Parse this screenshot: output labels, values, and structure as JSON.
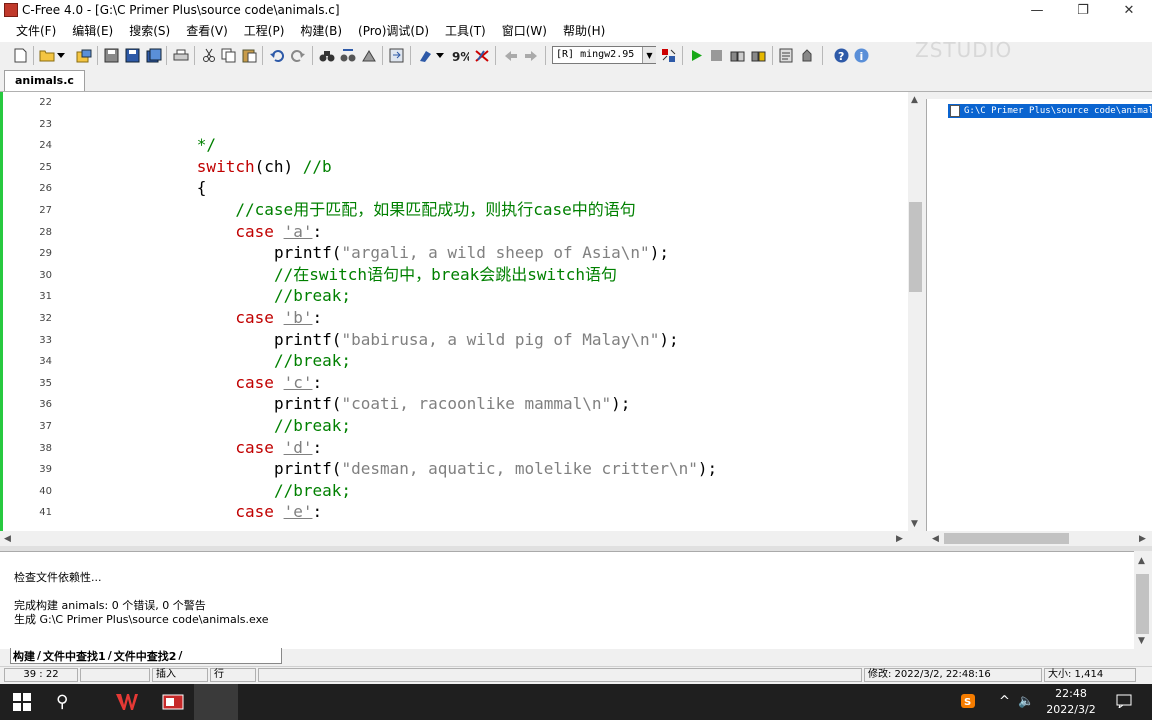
{
  "window": {
    "title": "C-Free 4.0 - [G:\\C Primer Plus\\source code\\animals.c]",
    "minimize_glyph": "—",
    "restore_glyph": "❐",
    "close_glyph": "✕"
  },
  "menu": [
    "文件(F)",
    "编辑(E)",
    "搜索(S)",
    "查看(V)",
    "工程(P)",
    "构建(B)",
    "(Pro)调试(D)",
    "工具(T)",
    "窗口(W)",
    "帮助(H)"
  ],
  "toolbar": {
    "compiler": "[R] mingw2.95",
    "icons": [
      "new-file-icon",
      "open-folder-icon",
      "open-dropdown-icon",
      "open-project-icon",
      "save-all-icon",
      "save-icon",
      "save-as-icon",
      "close-file-icon",
      "print-icon",
      "cut-icon",
      "copy-icon",
      "paste-icon",
      "delete-icon",
      "undo-icon",
      "redo-icon",
      "find-icon",
      "find-next-icon",
      "replace-icon",
      "goto-icon",
      "bookmark-icon",
      "bookmark-dropdown-icon",
      "toggle-bookmark-icon",
      "clear-bookmark-icon",
      "nav-back-icon",
      "nav-forward-icon",
      "compiler-settings-icon",
      "run-icon",
      "stop-icon",
      "build-icon",
      "rebuild-icon",
      "compile-icon",
      "debug-icon",
      "help-icon",
      "info-icon"
    ],
    "watermark": "ZSTUDIO"
  },
  "tabs": [
    "animals.c"
  ],
  "editor": {
    "lines": [
      {
        "n": "22",
        "parts": []
      },
      {
        "n": "23",
        "parts": []
      },
      {
        "n": "24",
        "indent": 12,
        "parts": [
          {
            "t": "*/",
            "c": "cmt"
          }
        ]
      },
      {
        "n": "25",
        "indent": 12,
        "parts": [
          {
            "t": "switch",
            "c": "kw"
          },
          {
            "t": "(ch) ",
            "c": ""
          },
          {
            "t": "//b",
            "c": "cmt"
          }
        ]
      },
      {
        "n": "26",
        "indent": 12,
        "parts": [
          {
            "t": "{",
            "c": ""
          }
        ]
      },
      {
        "n": "27",
        "indent": 16,
        "parts": [
          {
            "t": "//case用于匹配，如果匹配成功，则执行case中的语句",
            "c": "cmt"
          }
        ]
      },
      {
        "n": "28",
        "indent": 16,
        "parts": [
          {
            "t": "case",
            "c": "kw"
          },
          {
            "t": " ",
            "c": ""
          },
          {
            "t": "'a'",
            "c": "ch"
          },
          {
            "t": ":",
            "c": ""
          }
        ]
      },
      {
        "n": "29",
        "indent": 20,
        "parts": [
          {
            "t": "printf(",
            "c": ""
          },
          {
            "t": "\"argali, a wild sheep of Asia\\n\"",
            "c": "str"
          },
          {
            "t": ");",
            "c": ""
          }
        ]
      },
      {
        "n": "30",
        "indent": 20,
        "parts": [
          {
            "t": "//在switch语句中，break会跳出switch语句",
            "c": "cmt"
          }
        ]
      },
      {
        "n": "31",
        "indent": 20,
        "parts": [
          {
            "t": "//break;",
            "c": "cmt"
          }
        ]
      },
      {
        "n": "32",
        "indent": 16,
        "parts": [
          {
            "t": "case",
            "c": "kw"
          },
          {
            "t": " ",
            "c": ""
          },
          {
            "t": "'b'",
            "c": "ch"
          },
          {
            "t": ":",
            "c": ""
          }
        ]
      },
      {
        "n": "33",
        "indent": 20,
        "parts": [
          {
            "t": "printf(",
            "c": ""
          },
          {
            "t": "\"babirusa, a wild pig of Malay\\n\"",
            "c": "str"
          },
          {
            "t": ");",
            "c": ""
          }
        ]
      },
      {
        "n": "34",
        "indent": 20,
        "parts": [
          {
            "t": "//break;",
            "c": "cmt"
          }
        ]
      },
      {
        "n": "35",
        "indent": 16,
        "parts": [
          {
            "t": "case",
            "c": "kw"
          },
          {
            "t": " ",
            "c": ""
          },
          {
            "t": "'c'",
            "c": "ch"
          },
          {
            "t": ":",
            "c": ""
          }
        ]
      },
      {
        "n": "36",
        "indent": 20,
        "parts": [
          {
            "t": "printf(",
            "c": ""
          },
          {
            "t": "\"coati, racoonlike mammal\\n\"",
            "c": "str"
          },
          {
            "t": ");",
            "c": ""
          }
        ]
      },
      {
        "n": "37",
        "indent": 20,
        "parts": [
          {
            "t": "//break;",
            "c": "cmt"
          }
        ]
      },
      {
        "n": "38",
        "indent": 16,
        "parts": [
          {
            "t": "case",
            "c": "kw"
          },
          {
            "t": " ",
            "c": ""
          },
          {
            "t": "'d'",
            "c": "ch"
          },
          {
            "t": ":",
            "c": ""
          }
        ]
      },
      {
        "n": "39",
        "indent": 20,
        "parts": [
          {
            "t": "printf(",
            "c": ""
          },
          {
            "t": "\"desman, aquatic, molelike critter\\n\"",
            "c": "str"
          },
          {
            "t": ");",
            "c": ""
          }
        ]
      },
      {
        "n": "40",
        "indent": 20,
        "parts": [
          {
            "t": "//break;",
            "c": "cmt"
          }
        ]
      },
      {
        "n": "41",
        "indent": 16,
        "parts": [
          {
            "t": "case",
            "c": "kw"
          },
          {
            "t": " ",
            "c": ""
          },
          {
            "t": "'e'",
            "c": "ch"
          },
          {
            "t": ":",
            "c": ""
          }
        ]
      }
    ]
  },
  "file_tree": {
    "item": "G:\\C Primer Plus\\source code\\animals.c"
  },
  "output": {
    "lines": [
      "检查文件依赖性...",
      "",
      "完成构建 animals: 0 个错误, 0 个警告",
      "生成 G:\\C Primer Plus\\source code\\animals.exe"
    ],
    "tabs": [
      "构建",
      "文件中查找1",
      "文件中查找2"
    ]
  },
  "status": {
    "position": "39 : 22",
    "insert_mode": "插入",
    "line_mode": "行",
    "modified": "修改: 2022/3/2, 22:48:16",
    "size": "大小: 1,414"
  },
  "taskbar": {
    "time": "22:48",
    "date": "2022/3/2"
  },
  "colors": {
    "keyword": "#c00000",
    "comment": "#008000",
    "string": "#808080",
    "selection": "#0a64d0",
    "gutter_marker": "#27c93f"
  }
}
